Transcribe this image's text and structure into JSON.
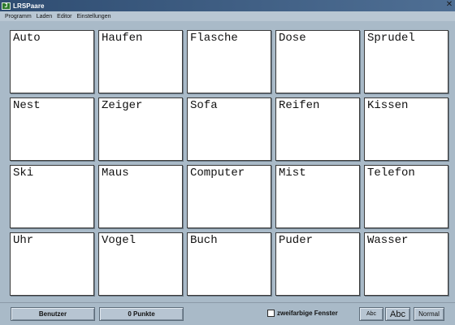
{
  "window": {
    "title": "LRSPaare",
    "app_icon_text": "J"
  },
  "menu": {
    "items": [
      {
        "label": "Programm"
      },
      {
        "label": "Laden"
      },
      {
        "label": "Editor"
      },
      {
        "label": "Einstellungen"
      }
    ]
  },
  "cards": [
    {
      "word": "Auto"
    },
    {
      "word": "Haufen"
    },
    {
      "word": "Flasche"
    },
    {
      "word": "Dose"
    },
    {
      "word": "Sprudel"
    },
    {
      "word": "Nest"
    },
    {
      "word": "Zeiger"
    },
    {
      "word": "Sofa"
    },
    {
      "word": "Reifen"
    },
    {
      "word": "Kissen"
    },
    {
      "word": "Ski"
    },
    {
      "word": "Maus"
    },
    {
      "word": "Computer"
    },
    {
      "word": "Mist"
    },
    {
      "word": "Telefon"
    },
    {
      "word": "Uhr"
    },
    {
      "word": "Vogel"
    },
    {
      "word": "Buch"
    },
    {
      "word": "Puder"
    },
    {
      "word": "Wasser"
    }
  ],
  "footer": {
    "benutzer_label": "Benutzer",
    "punkte_label": "0 Punkte",
    "two_color_label": "zweifarbige Fenster",
    "two_color_checked": false,
    "font_small_label": "Abc",
    "font_large_label": "Abc",
    "normal_label": "Normal"
  },
  "colors": {
    "background": "#a9bac8",
    "titlebar": "#2f4d72",
    "card": "#ffffff"
  }
}
